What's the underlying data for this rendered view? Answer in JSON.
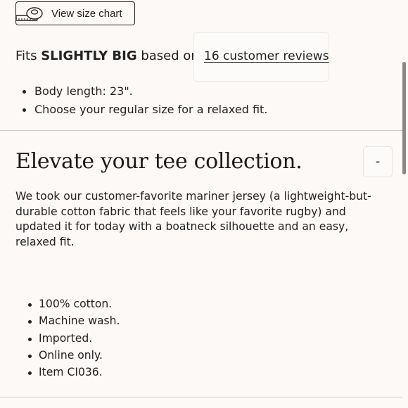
{
  "size_chart": {
    "label": "View size chart",
    "icon": "tape-measure-icon"
  },
  "fit": {
    "prefix": "Fits ",
    "emphasis": "SLIGHTLY BIG",
    "suffix": " based on",
    "reviews_link": "16 customer reviews"
  },
  "fit_notes": [
    "Body length: 23\".",
    "Choose your regular size for a relaxed fit."
  ],
  "section": {
    "title": "Elevate your tee collection.",
    "toggle_label": "-",
    "description": "We took our customer-favorite mariner jersey (a lightweight-but-durable cotton fabric that feels like your favorite rugby) and updated it for today with a boatneck silhouette and an easy, relaxed fit.",
    "details": [
      "100% cotton.",
      "Machine wash.",
      "Imported.",
      "Online only.",
      "Item CI036."
    ]
  },
  "colors": {
    "background": "#fcf9f7",
    "text": "#1f1f1f",
    "divider": "#cfcac5"
  }
}
